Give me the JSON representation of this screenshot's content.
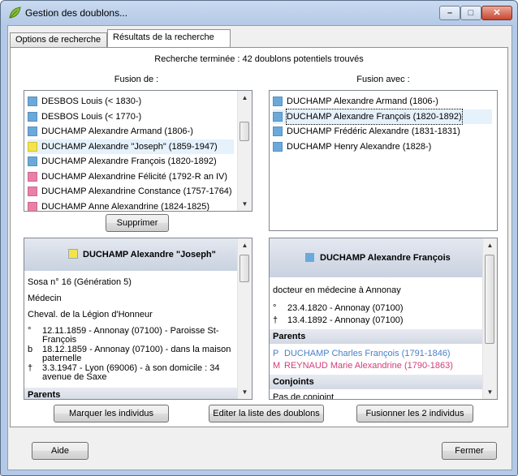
{
  "window": {
    "title": "Gestion des doublons..."
  },
  "tabs": [
    {
      "label": "Options de recherche"
    },
    {
      "label": "Résultats de la recherche"
    }
  ],
  "status": "Recherche terminée : 42 doublons potentiels trouvés",
  "left": {
    "header": "Fusion de :",
    "items": [
      {
        "label": "DESBOS Louis (< 1830-)",
        "color": "#6aa9dc"
      },
      {
        "label": "DESBOS Louis (< 1770-)",
        "color": "#6aa9dc"
      },
      {
        "label": "DUCHAMP Alexandre Armand (1806-)",
        "color": "#6aa9dc"
      },
      {
        "label": "DUCHAMP Alexandre \"Joseph\" (1859-1947)",
        "color": "#f5e34a"
      },
      {
        "label": "DUCHAMP Alexandre François (1820-1892)",
        "color": "#6aa9dc"
      },
      {
        "label": "DUCHAMP Alexandrine Félicité (1792-R an IV)",
        "color": "#ec7fa7"
      },
      {
        "label": "DUCHAMP Alexandrine Constance (1757-1764)",
        "color": "#ec7fa7"
      },
      {
        "label": "DUCHAMP Anne Alexandrine (1824-1825)",
        "color": "#ec7fa7"
      }
    ],
    "delete_label": "Supprimer"
  },
  "right": {
    "header": "Fusion avec :",
    "items": [
      {
        "label": "DUCHAMP Alexandre Armand (1806-)",
        "color": "#6aa9dc"
      },
      {
        "label": "DUCHAMP Alexandre François (1820-1892)",
        "color": "#6aa9dc"
      },
      {
        "label": "DUCHAMP Frédéric Alexandre (1831-1831)",
        "color": "#6aa9dc"
      },
      {
        "label": "DUCHAMP Henry Alexandre (1828-)",
        "color": "#6aa9dc"
      }
    ]
  },
  "detail_left": {
    "name": "DUCHAMP Alexandre \"Joseph\"",
    "sosa": "Sosa n° 16 (Génération 5)",
    "occupation": "Médecin",
    "honor": "Cheval. de la Légion d'Honneur",
    "events": [
      {
        "sym": "°",
        "line1": "12.11.1859 - Annonay (07100) - Paroisse St-",
        "line2": "François"
      },
      {
        "sym": "b",
        "line1": "18.12.1859 - Annonay (07100) - dans la maison",
        "line2": "paternelle"
      },
      {
        "sym": "†",
        "line1": "3.3.1947 - Lyon (69006) - à son domicile : 34",
        "line2": "avenue de Saxe"
      }
    ],
    "section_parents": "Parents"
  },
  "detail_right": {
    "name": "DUCHAMP Alexandre François",
    "occupation": "docteur en médecine à Annonay",
    "events": [
      {
        "sym": "°",
        "text": "23.4.1820 - Annonay (07100)"
      },
      {
        "sym": "†",
        "text": "13.4.1892 - Annonay (07100)"
      }
    ],
    "section_parents": "Parents",
    "parents": [
      {
        "sym": "P",
        "text": "DUCHAMP Charles François (1791-1846)",
        "color": "#4a7fc8"
      },
      {
        "sym": "M",
        "text": "REYNAUD Marie Alexandrine (1790-1863)",
        "color": "#d23c78"
      }
    ],
    "section_spouses": "Conjoints",
    "no_spouse": "Pas de conjoint"
  },
  "buttons": {
    "mark": "Marquer les individus",
    "edit": "Editer la liste des doublons",
    "merge": "Fusionner les 2 individus",
    "help": "Aide",
    "close": "Fermer"
  }
}
